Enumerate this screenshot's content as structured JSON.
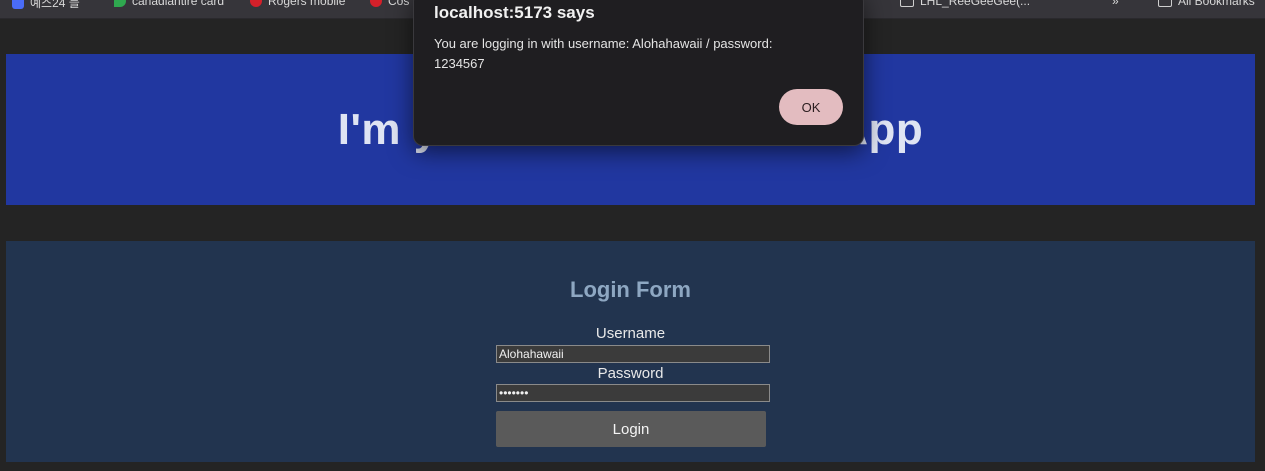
{
  "bookmarks": {
    "items": [
      {
        "label": "예스24 블",
        "icon": "app-icon",
        "color": "#4a6cf7"
      },
      {
        "label": "canadiantire card",
        "icon": "map-pin-icon",
        "color": "#2fa84f"
      },
      {
        "label": "Rogers mobile",
        "icon": "shield-icon",
        "color": "#d4202a"
      },
      {
        "label": "Cos",
        "icon": "shield-icon",
        "color": "#d4202a"
      },
      {
        "label": "LHL_ReeGeeGee(...",
        "icon": "page-icon",
        "color": "#cfcfcf"
      }
    ],
    "overflow_label": "»",
    "all_bookmarks_label": "All Bookmarks"
  },
  "banner": {
    "title": "I'm your Kobeen Dome App",
    "bg": "#2137a0"
  },
  "login": {
    "title": "Login Form",
    "username_label": "Username",
    "username_value": "Alohahawaii",
    "password_label": "Password",
    "password_value": "1234567",
    "button_label": "Login"
  },
  "dialog": {
    "title": "localhost:5173 says",
    "message": "You are logging in with username: Alohahawaii / password: 1234567",
    "ok_label": "OK",
    "ok_color": "#e3bcc0"
  }
}
